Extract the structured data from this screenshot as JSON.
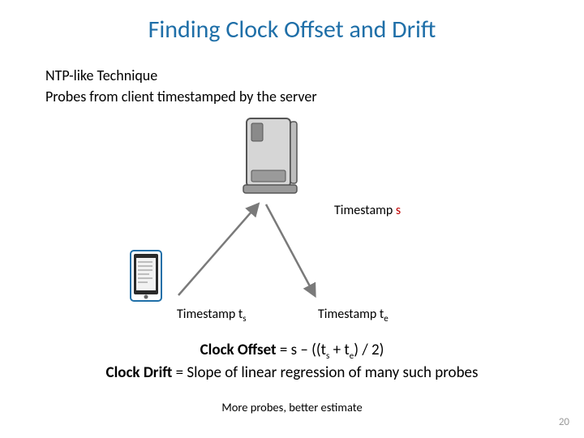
{
  "title": "Finding Clock Offset and Drift",
  "line1": "NTP-like Technique",
  "line2": "Probes from client timestamped by the server",
  "ts_label_prefix": "Timestamp ",
  "ts_s": "s",
  "ts_ts_main": "t",
  "ts_ts_sub": "s",
  "ts_te_main": "t",
  "ts_te_sub": "e",
  "formula1_bold": "Clock Offset",
  "formula1_rest_a": " = s – ((t",
  "formula1_sub1": "s",
  "formula1_rest_b": " + t",
  "formula1_sub2": "e",
  "formula1_rest_c": ") / 2)",
  "formula2_bold": "Clock Drift",
  "formula2_rest": " = Slope of linear regression of many such probes",
  "footnote": "More probes, better estimate",
  "pagenum": "20"
}
